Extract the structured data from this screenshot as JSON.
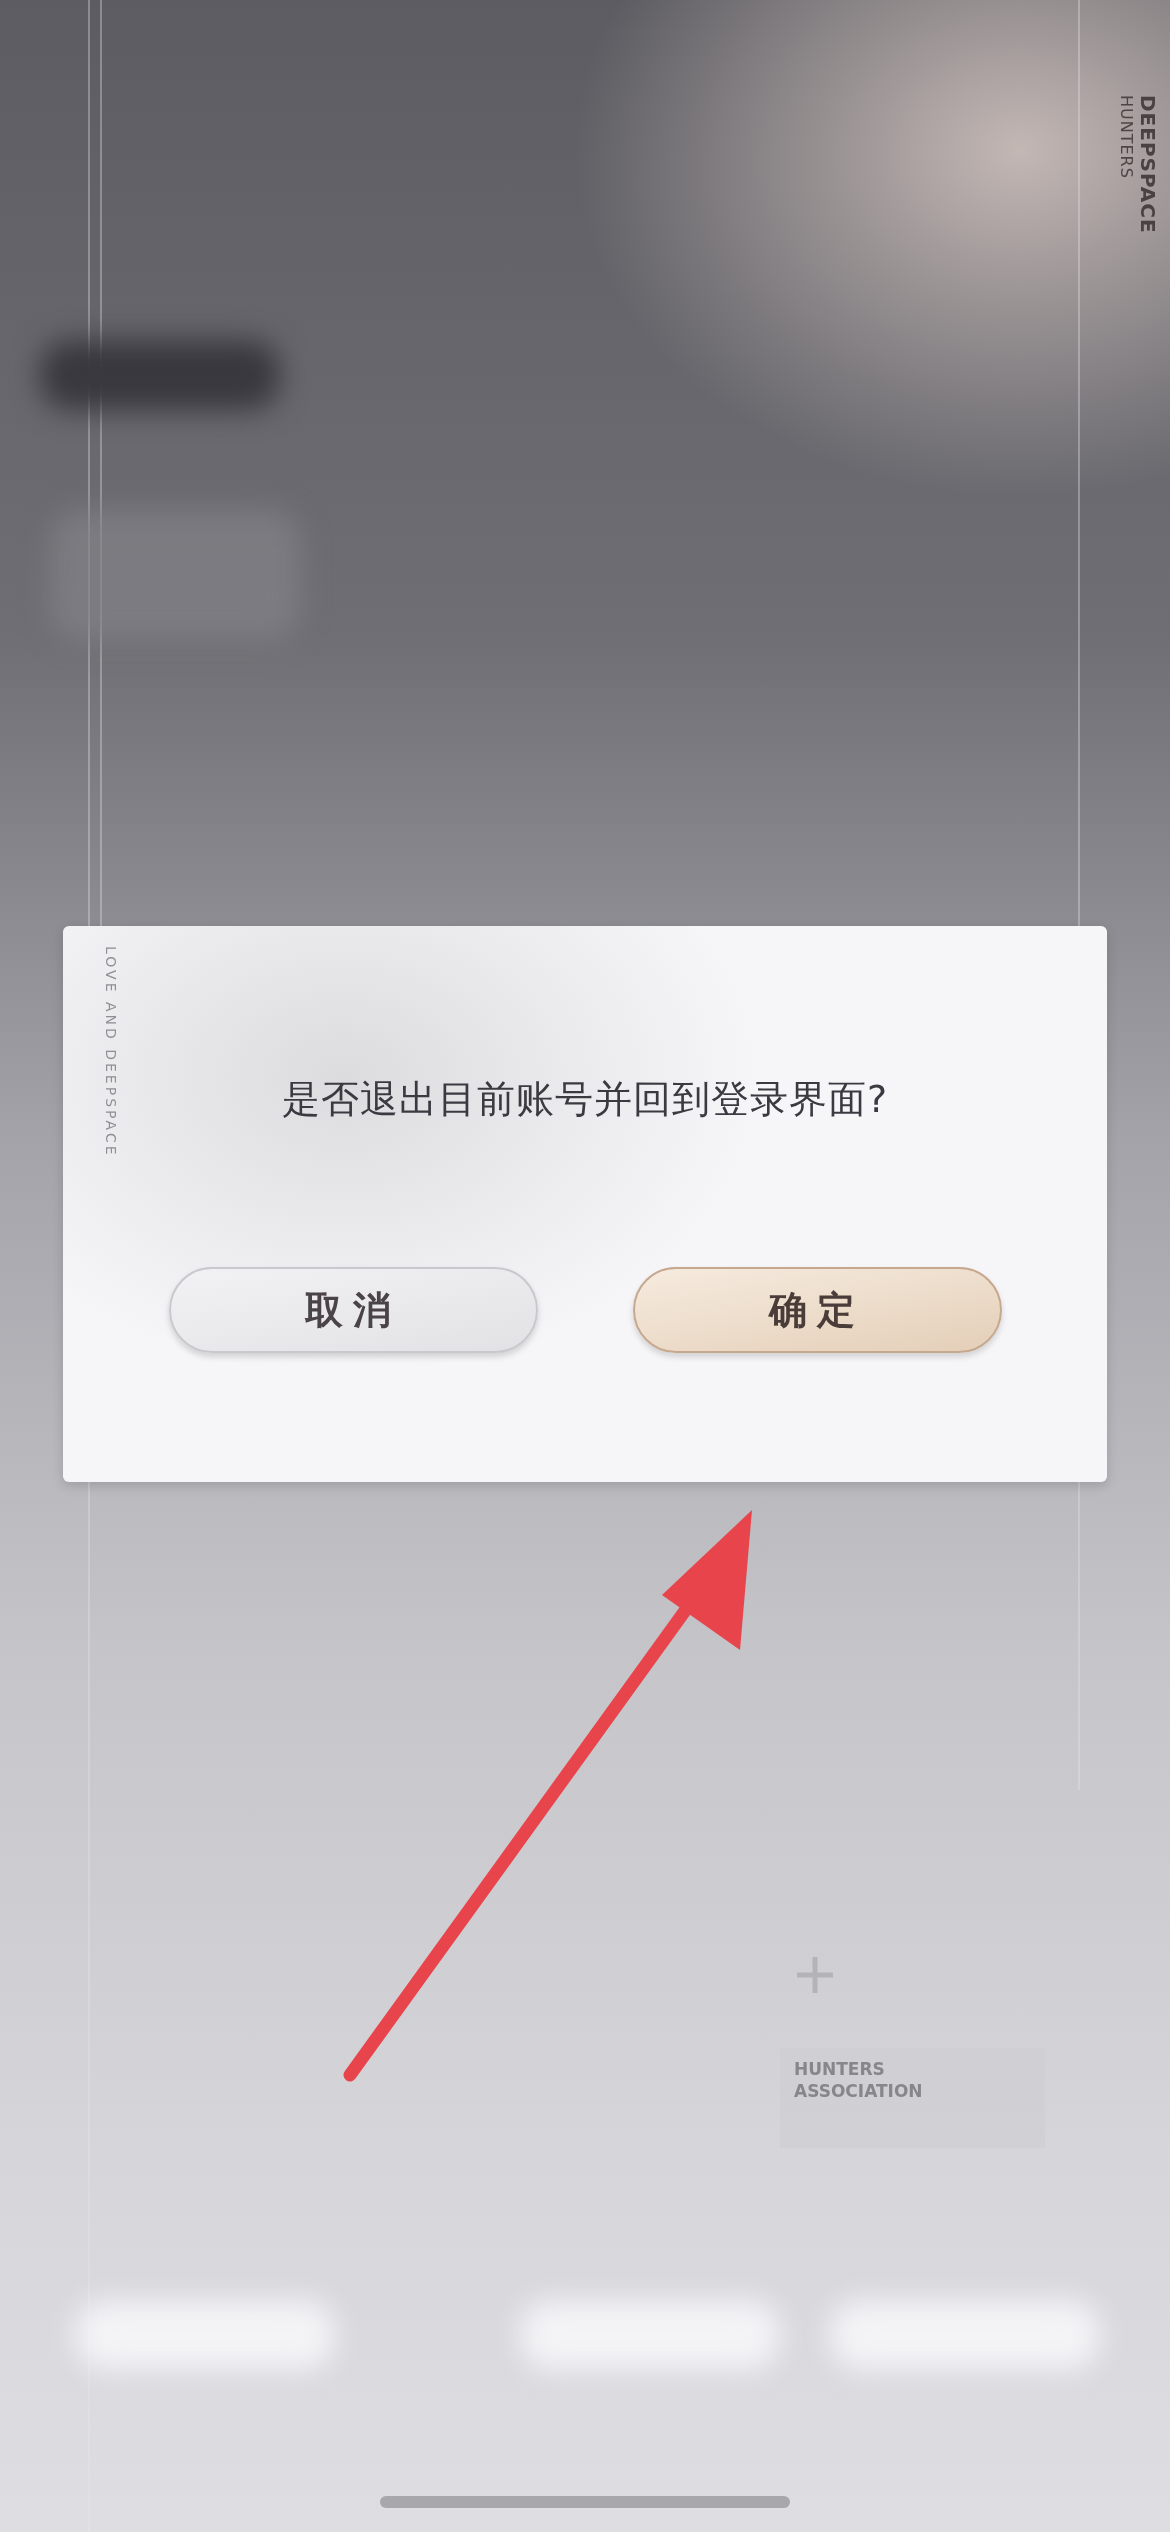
{
  "background": {
    "brand_title": "DEEPSPACE",
    "brand_subtitle": "HUNTERS",
    "card_title": "HUNTERS ASSOCIATION"
  },
  "dialog": {
    "side_label": "LOVE AND DEEPSPACE",
    "message": "是否退出目前账号并回到登录界面?",
    "buttons": [
      {
        "label": "取消",
        "kind": "secondary"
      },
      {
        "label": "确定",
        "kind": "primary"
      }
    ]
  }
}
